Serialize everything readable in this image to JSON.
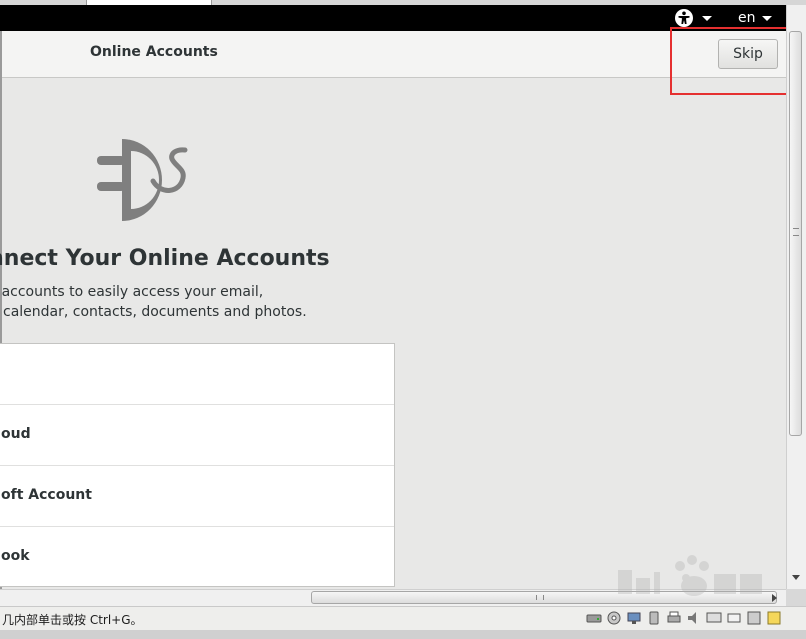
{
  "topbar": {
    "accessibility_icon": "accessibility-icon",
    "language": "en"
  },
  "header": {
    "title": "Online Accounts",
    "skip_label": "Skip"
  },
  "main": {
    "logo_icon": "online-accounts-plug-icon",
    "heading": "onnect Your Online Accounts",
    "description_line1": "ct your accounts to easily access your email,",
    "description_line2": "calendar, contacts, documents and photos.",
    "accounts": [
      {
        "label": ""
      },
      {
        "label": "oud"
      },
      {
        "label": "oft Account"
      },
      {
        "label": "ook"
      }
    ]
  },
  "statusbar": {
    "text": "几内部单击或按 Ctrl+G。"
  },
  "colors": {
    "highlight_border": "#e53030",
    "topbar_bg": "#000000",
    "content_bg": "#e8e8e7",
    "logo_gray": "#7f7f7f"
  }
}
